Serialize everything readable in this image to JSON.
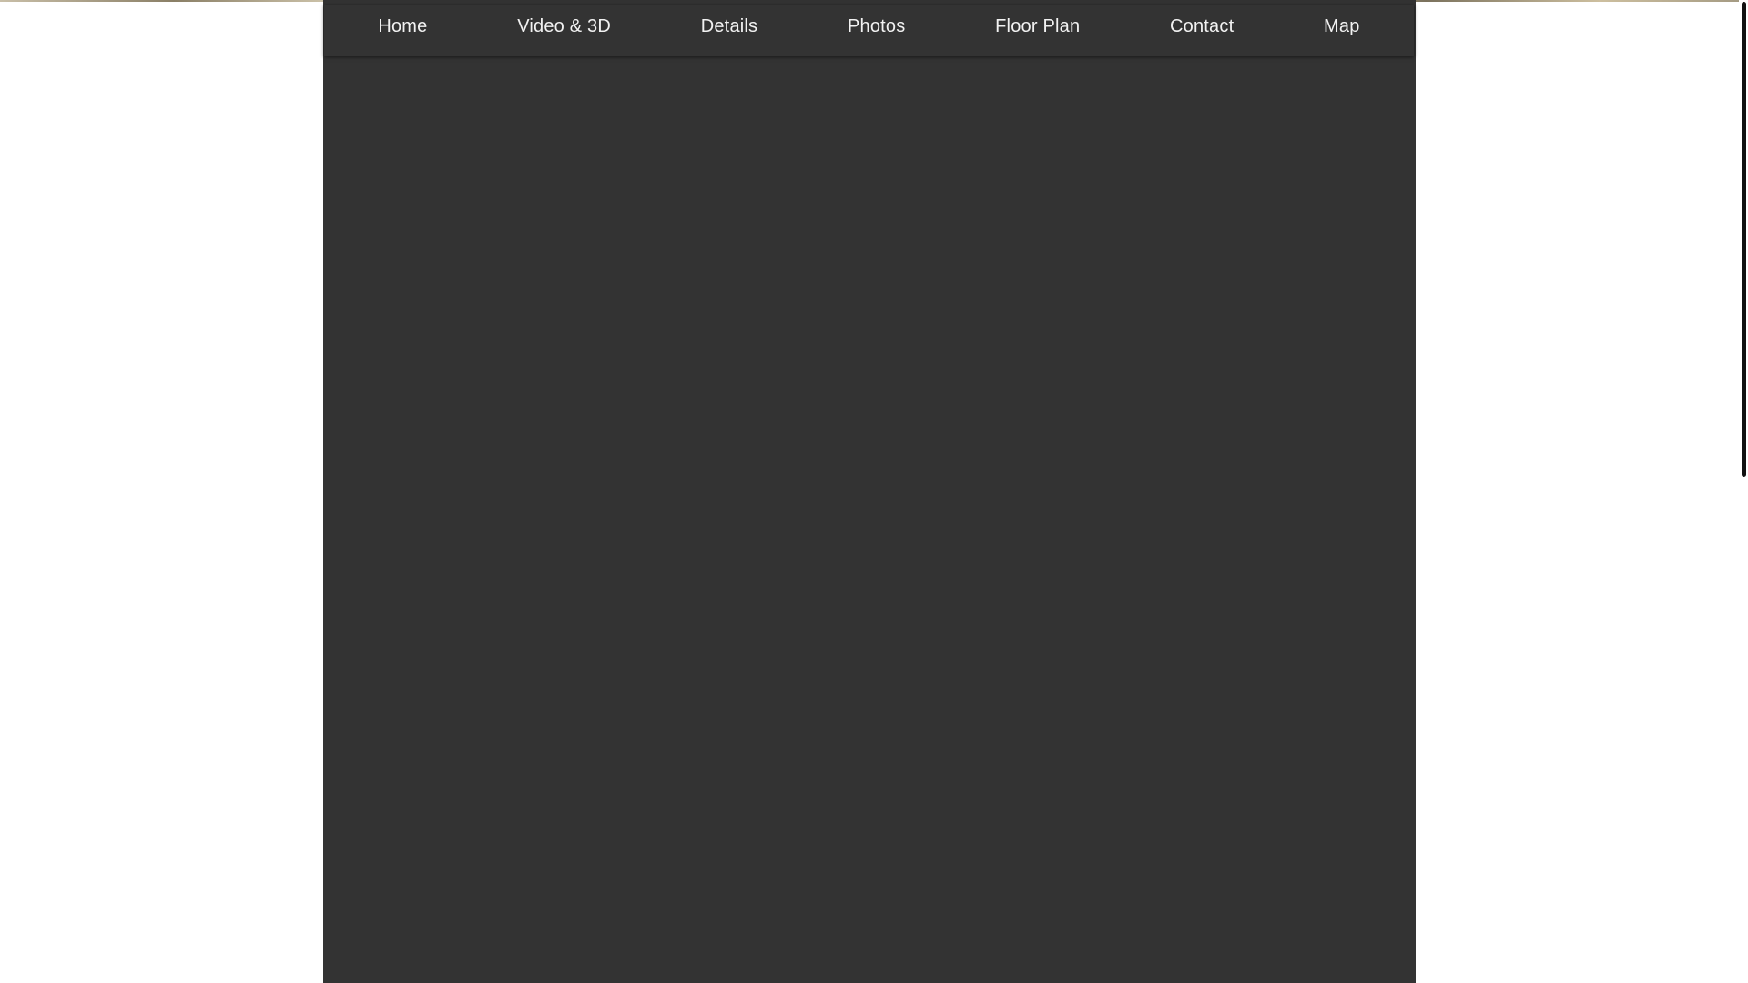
{
  "navbar": {
    "items": [
      {
        "label": "Home"
      },
      {
        "label": "Video & 3D"
      },
      {
        "label": "Details"
      },
      {
        "label": "Photos"
      },
      {
        "label": "Floor Plan"
      },
      {
        "label": "Contact"
      },
      {
        "label": "Map"
      }
    ]
  },
  "colors": {
    "panel_background": "#333333",
    "nav_text": "#f2f2f2",
    "page_background": "#ffffff"
  }
}
